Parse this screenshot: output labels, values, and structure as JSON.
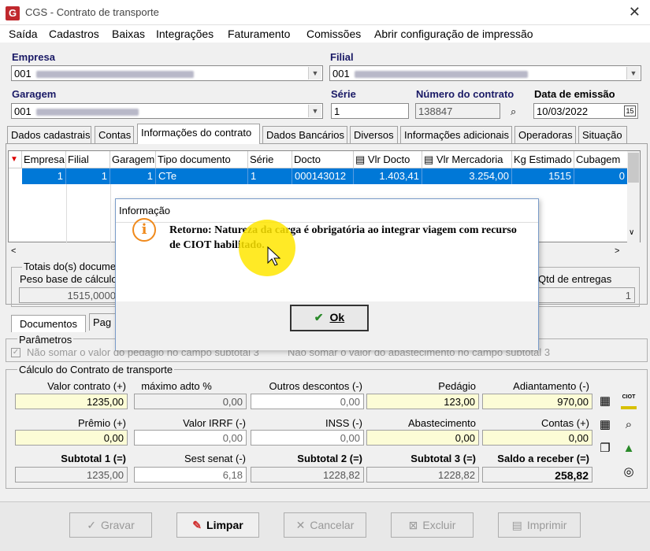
{
  "window": {
    "title": "CGS - Contrato de transporte",
    "app_logo": "G",
    "close": "✕"
  },
  "menu": [
    "Saída",
    "Cadastros",
    "Baixas",
    "Integrações",
    "Faturamento",
    "Comissões",
    "Abrir configuração de impressão"
  ],
  "header": {
    "empresa_label": "Empresa",
    "empresa_value": "001",
    "filial_label": "Filial",
    "filial_value": "001",
    "garagem_label": "Garagem",
    "garagem_value": "001",
    "serie_label": "Série",
    "serie_value": "1",
    "numero_label": "Número do contrato",
    "numero_value": "138847",
    "data_label": "Data de emissão",
    "data_value": "10/03/2022"
  },
  "tabs": [
    "Dados cadastrais",
    "Contas",
    "Informações do contrato",
    "Dados Bancários",
    "Diversos",
    "Informações adicionais",
    "Operadoras",
    "Situação"
  ],
  "grid": {
    "columns": [
      "Empresa",
      "Filial",
      "Garagem",
      "Tipo documento",
      "Série",
      "Docto",
      "Vlr Docto",
      "Vlr Mercadoria",
      "Kg Estimado",
      "Cubagem"
    ],
    "rows": [
      [
        "1",
        "1",
        "1",
        "CTe",
        "1",
        "000143012",
        "1.403,41",
        "3.254,00",
        "1515",
        "0"
      ]
    ]
  },
  "totais": {
    "legend": "Totais do(s) docume",
    "peso_label": "Peso base de cálculo",
    "peso_value": "1515,0000",
    "qtd_label": "Qtd de entregas",
    "qtd_value": "1"
  },
  "subtabs": [
    "Documentos",
    "Pag"
  ],
  "parametros": {
    "legend": "Parâmetros",
    "opt1": "Não somar o valor do pedágio no campo subtotal 3",
    "opt2": "Não somar o valor do abastecimento no campo subtotal 3"
  },
  "calculo": {
    "legend": "Cálculo do Contrato de transporte",
    "valor_contrato_label": "Valor contrato (+)",
    "valor_contrato": "1235,00",
    "max_adto_label": "máximo adto %",
    "max_adto": "0,00",
    "outros_label": "Outros descontos (-)",
    "outros": "0,00",
    "pedagio_label": "Pedágio",
    "pedagio": "123,00",
    "adiantamento_label": "Adiantamento (-)",
    "adiantamento": "970,00",
    "premio_label": "Prêmio (+)",
    "premio": "0,00",
    "irrf_label": "Valor IRRF (-)",
    "irrf": "0,00",
    "inss_label": "INSS (-)",
    "inss": "0,00",
    "abastecimento_label": "Abastecimento",
    "abastecimento": "0,00",
    "contas_label": "Contas (+)",
    "contas": "0,00",
    "sub1_label": "Subtotal 1 (=)",
    "sub1": "1235,00",
    "sest_label": "Sest senat (-)",
    "sest": "6,18",
    "sub2_label": "Subtotal 2 (=)",
    "sub2": "1228,82",
    "sub3_label": "Subtotal 3 (=)",
    "sub3": "1228,82",
    "saldo_label": "Saldo a receber (=)",
    "saldo": "258,82",
    "ciot_label": "CIOT"
  },
  "buttons": {
    "gravar": "Gravar",
    "limpar": "Limpar",
    "cancelar": "Cancelar",
    "excluir": "Excluir",
    "imprimir": "Imprimir"
  },
  "dialog": {
    "title": "Informação",
    "message": "Retorno: Natureza da carga é obrigatória ao integrar viagem com recurso de CIOT habilitado.",
    "ok": "Ok",
    "icon": "i"
  },
  "colors": {
    "selection": "#0078d7",
    "required": "#fcfcd6",
    "info": "#f08a1c",
    "highlight": "#ffe600"
  }
}
